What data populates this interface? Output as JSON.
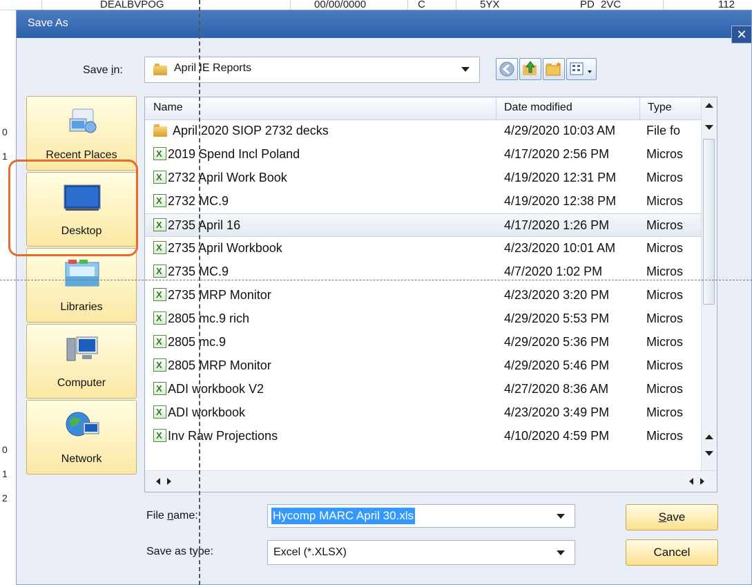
{
  "sheet": {
    "top_row": [
      "DEALBVPOG",
      "00/00/0000",
      "C",
      "5YX",
      "PD",
      "2VC",
      "112"
    ],
    "row_numbers": [
      "0",
      "1",
      "0",
      "1",
      "2"
    ]
  },
  "dialog": {
    "title": "Save As",
    "close_glyph": "✕",
    "save_in_label_pre": "Save ",
    "save_in_label_u": "i",
    "save_in_label_post": "n:",
    "save_in_value": "April IE Reports"
  },
  "places": [
    {
      "label": "Recent Places",
      "icon": "recent-places-icon"
    },
    {
      "label": "Desktop",
      "icon": "desktop-icon"
    },
    {
      "label": "Libraries",
      "icon": "libraries-icon"
    },
    {
      "label": "Computer",
      "icon": "computer-icon"
    },
    {
      "label": "Network",
      "icon": "network-icon"
    }
  ],
  "columns": {
    "name": "Name",
    "date": "Date modified",
    "type": "Type"
  },
  "files": [
    {
      "name": "April 2020 SIOP 2732 decks",
      "date": "4/29/2020 10:03 AM",
      "type": "File fo",
      "kind": "folder"
    },
    {
      "name": "2019 Spend Incl Poland",
      "date": "4/17/2020 2:56 PM",
      "type": "Micros",
      "kind": "excel"
    },
    {
      "name": "2732 April Work Book",
      "date": "4/19/2020 12:31 PM",
      "type": "Micros",
      "kind": "excel"
    },
    {
      "name": "2732 MC.9",
      "date": "4/19/2020 12:38 PM",
      "type": "Micros",
      "kind": "excel"
    },
    {
      "name": "2735 April 16",
      "date": "4/17/2020 1:26 PM",
      "type": "Micros",
      "kind": "excel"
    },
    {
      "name": "2735 April Workbook",
      "date": "4/23/2020 10:01 AM",
      "type": "Micros",
      "kind": "excel"
    },
    {
      "name": "2735 MC.9",
      "date": "4/7/2020 1:02 PM",
      "type": "Micros",
      "kind": "excel"
    },
    {
      "name": "2735 MRP Monitor",
      "date": "4/23/2020 3:20 PM",
      "type": "Micros",
      "kind": "excel"
    },
    {
      "name": "2805 mc.9 rich",
      "date": "4/29/2020 5:53 PM",
      "type": "Micros",
      "kind": "excel"
    },
    {
      "name": "2805 mc.9",
      "date": "4/29/2020 5:36 PM",
      "type": "Micros",
      "kind": "excel"
    },
    {
      "name": "2805 MRP Monitor",
      "date": "4/29/2020 5:46 PM",
      "type": "Micros",
      "kind": "excel"
    },
    {
      "name": "ADI workbook V2",
      "date": "4/27/2020 8:36 AM",
      "type": "Micros",
      "kind": "excel"
    },
    {
      "name": "ADI workbook",
      "date": "4/23/2020 3:49 PM",
      "type": "Micros",
      "kind": "excel"
    },
    {
      "name": "Inv Raw Projections",
      "date": "4/10/2020 4:59 PM",
      "type": "Micros",
      "kind": "excel"
    }
  ],
  "selected_index": 4,
  "form": {
    "file_name_label_pre": "File ",
    "file_name_label_u": "n",
    "file_name_label_post": "ame:",
    "file_name_value": "Hycomp MARC April 30.xls",
    "save_type_label": "Save as type:",
    "save_type_value": "Excel (*.XLSX)",
    "save_button_u": "S",
    "save_button_post": "ave",
    "cancel_button": "Cancel"
  },
  "colors": {
    "highlight": "#e76a2a",
    "title_bar": "#2f62ad",
    "selection": "#3399ff"
  }
}
